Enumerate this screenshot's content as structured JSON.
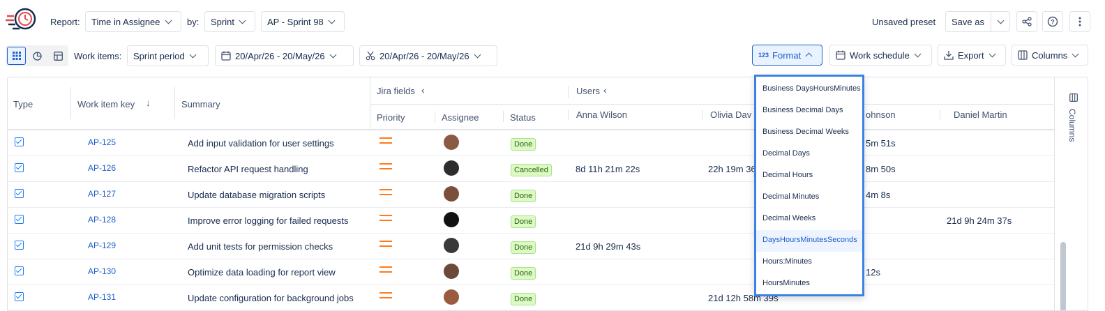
{
  "toolbar": {
    "report_label": "Report:",
    "report_value": "Time in Assignee",
    "by_label": "by:",
    "by_value": "Sprint",
    "sprint_value": "AP - Sprint 98",
    "unsaved_label": "Unsaved preset",
    "save_as": "Save as"
  },
  "toolbar2": {
    "work_items_label": "Work items:",
    "period_value": "Sprint period",
    "date_range_1": "20/Apr/26 - 20/May/26",
    "date_range_2": "20/Apr/26 - 20/May/26",
    "format": "Format",
    "format_icon_text": "123",
    "work_schedule": "Work schedule",
    "export": "Export",
    "columns": "Columns"
  },
  "table": {
    "headers": {
      "type": "Type",
      "key": "Work item key",
      "summary": "Summary",
      "jira_fields": "Jira fields",
      "users": "Users",
      "priority": "Priority",
      "assignee": "Assignee",
      "status": "Status",
      "user1": "Anna Wilson",
      "user2": "Olivia Dav",
      "user3": "ohnson",
      "user4": "Daniel Martin"
    },
    "side_panel": "Columns",
    "rows": [
      {
        "key": "AP-125",
        "summary": "Add input validation for user settings",
        "status": "Done",
        "u1": "",
        "u2": "",
        "u3": "5m 51s",
        "u4": ""
      },
      {
        "key": "AP-126",
        "summary": "Refactor API request handling",
        "status": "Cancelled",
        "u1": "8d 11h 21m 22s",
        "u2": "22h 19m 36",
        "u3": "8m 50s",
        "u4": ""
      },
      {
        "key": "AP-127",
        "summary": "Update database migration scripts",
        "status": "Done",
        "u1": "",
        "u2": "",
        "u3": "4m 8s",
        "u4": ""
      },
      {
        "key": "AP-128",
        "summary": "Improve error logging for failed requests",
        "status": "Done",
        "u1": "",
        "u2": "",
        "u3": "",
        "u4": "21d 9h 24m 37s"
      },
      {
        "key": "AP-129",
        "summary": "Add unit tests for permission checks",
        "status": "Done",
        "u1": "21d 9h 29m 43s",
        "u2": "",
        "u3": "",
        "u4": ""
      },
      {
        "key": "AP-130",
        "summary": "Optimize data loading for report view",
        "status": "Done",
        "u1": "",
        "u2": "",
        "u3": "12s",
        "u4": ""
      },
      {
        "key": "AP-131",
        "summary": "Update configuration for background jobs",
        "status": "Done",
        "u1": "",
        "u2": "21d 12h 58m 39s",
        "u3": "",
        "u4": ""
      }
    ]
  },
  "format_menu": {
    "items": [
      "Business DaysHoursMinutes",
      "Business Decimal Days",
      "Business Decimal Weeks",
      "Decimal Days",
      "Decimal Hours",
      "Decimal Minutes",
      "Decimal Weeks",
      "DaysHoursMinutesSeconds",
      "Hours:Minutes",
      "HoursMinutes"
    ],
    "selected": "DaysHoursMinutesSeconds"
  },
  "colors": {
    "accent": "#1d5fc9",
    "menu_border": "#3b82e6",
    "priority": "#ff7a1a",
    "done_badge": "#dcfbc4"
  }
}
